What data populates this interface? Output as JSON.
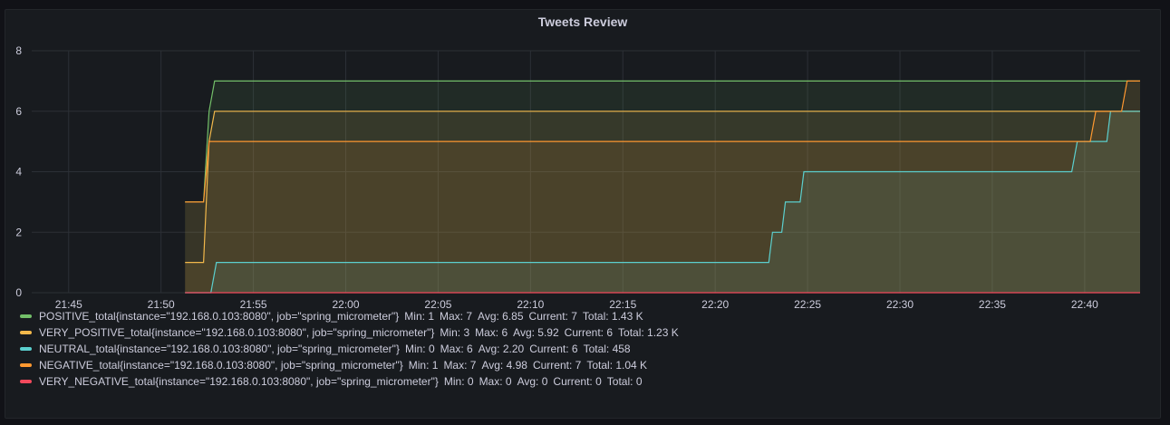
{
  "panel": {
    "title": "Tweets Review"
  },
  "colors": {
    "background": "#181b1f",
    "grid": "#2c3036",
    "text": "#ccccdc"
  },
  "chart_data": {
    "type": "line",
    "title": "Tweets Review",
    "xlabel": "",
    "ylabel": "",
    "x_ticks": [
      "21:45",
      "21:50",
      "21:55",
      "22:00",
      "22:05",
      "22:10",
      "22:15",
      "22:20",
      "22:25",
      "22:30",
      "22:35",
      "22:40"
    ],
    "x_range": [
      "21:43",
      "22:43"
    ],
    "ylim": [
      0,
      8
    ],
    "y_ticks": [
      0,
      2,
      4,
      6,
      8
    ],
    "grid": true,
    "legend_position": "bottom-left",
    "series": [
      {
        "name": "POSITIVE_total{instance=\"192.168.0.103:8080\", job=\"spring_micrometer\"}",
        "color": "#73bf69",
        "points": [
          [
            "21:51.3",
            3
          ],
          [
            "21:52.3",
            3
          ],
          [
            "21:52.6",
            6
          ],
          [
            "21:52.9",
            7
          ],
          [
            "22:43",
            7
          ]
        ],
        "stats": {
          "min_label": "Min:",
          "min": "1",
          "max_label": "Max:",
          "max": "7",
          "avg_label": "Avg:",
          "avg": "6.85",
          "current_label": "Current:",
          "current": "7",
          "total_label": "Total:",
          "total": "1.43 K"
        }
      },
      {
        "name": "VERY_POSITIVE_total{instance=\"192.168.0.103:8080\", job=\"spring_micrometer\"}",
        "color": "#f2b84b",
        "points": [
          [
            "21:51.3",
            1
          ],
          [
            "21:52.3",
            1
          ],
          [
            "21:52.6",
            5
          ],
          [
            "21:52.9",
            6
          ],
          [
            "22:43",
            6
          ]
        ],
        "stats": {
          "min_label": "Min:",
          "min": "3",
          "max_label": "Max:",
          "max": "6",
          "avg_label": "Avg:",
          "avg": "5.92",
          "current_label": "Current:",
          "current": "6",
          "total_label": "Total:",
          "total": "1.23 K"
        }
      },
      {
        "name": "NEUTRAL_total{instance=\"192.168.0.103:8080\", job=\"spring_micrometer\"}",
        "color": "#5bcfce",
        "points": [
          [
            "21:51.3",
            0
          ],
          [
            "21:52.7",
            0
          ],
          [
            "21:53.0",
            1
          ],
          [
            "22:22.9",
            1
          ],
          [
            "22:23.1",
            2
          ],
          [
            "22:23.6",
            2
          ],
          [
            "22:23.8",
            3
          ],
          [
            "22:24.6",
            3
          ],
          [
            "22:24.8",
            4
          ],
          [
            "22:39.3",
            4
          ],
          [
            "22:39.6",
            5
          ],
          [
            "22:41.2",
            5
          ],
          [
            "22:41.4",
            6
          ],
          [
            "22:43",
            6
          ]
        ],
        "stats": {
          "min_label": "Min:",
          "min": "0",
          "max_label": "Max:",
          "max": "6",
          "avg_label": "Avg:",
          "avg": "2.20",
          "current_label": "Current:",
          "current": "6",
          "total_label": "Total:",
          "total": "458"
        }
      },
      {
        "name": "NEGATIVE_total{instance=\"192.168.0.103:8080\", job=\"spring_micrometer\"}",
        "color": "#ff9830",
        "points": [
          [
            "21:51.3",
            3
          ],
          [
            "21:52.3",
            3
          ],
          [
            "21:52.6",
            5
          ],
          [
            "22:40.3",
            5
          ],
          [
            "22:40.6",
            6
          ],
          [
            "22:42.0",
            6
          ],
          [
            "22:42.3",
            7
          ],
          [
            "22:43",
            7
          ]
        ],
        "stats": {
          "min_label": "Min:",
          "min": "1",
          "max_label": "Max:",
          "max": "7",
          "avg_label": "Avg:",
          "avg": "4.98",
          "current_label": "Current:",
          "current": "7",
          "total_label": "Total:",
          "total": "1.04 K"
        }
      },
      {
        "name": "VERY_NEGATIVE_total{instance=\"192.168.0.103:8080\", job=\"spring_micrometer\"}",
        "color": "#f2495c",
        "points": [
          [
            "21:51.3",
            0
          ],
          [
            "22:43",
            0
          ]
        ],
        "stats": {
          "min_label": "Min:",
          "min": "0",
          "max_label": "Max:",
          "max": "0",
          "avg_label": "Avg:",
          "avg": "0",
          "current_label": "Current:",
          "current": "0",
          "total_label": "Total:",
          "total": "0"
        }
      }
    ]
  }
}
